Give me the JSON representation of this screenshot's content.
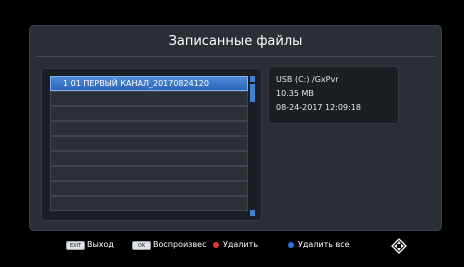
{
  "window": {
    "title": "Записанные файлы"
  },
  "files": [
    {
      "label": "1  01 ПЕРВЫЙ КАНАЛ_20170824120",
      "selected": true
    },
    {
      "label": ""
    },
    {
      "label": ""
    },
    {
      "label": ""
    },
    {
      "label": ""
    },
    {
      "label": ""
    },
    {
      "label": ""
    },
    {
      "label": ""
    },
    {
      "label": ""
    }
  ],
  "info": {
    "path": "USB (C:) /GxPvr",
    "size": "10.35 MB",
    "datetime": "08-24-2017 12:09:18"
  },
  "footer": {
    "exit_key": "EXIT",
    "exit_label": "Выход",
    "ok_key": "OK",
    "play_label": "Воспроизвес",
    "delete_label": "Удалить",
    "delete_all_label": "Удалить все"
  },
  "colors": {
    "delete_dot": "#e53a2a",
    "delete_all_dot": "#2f6fe0",
    "selection": "#3a78cc"
  }
}
